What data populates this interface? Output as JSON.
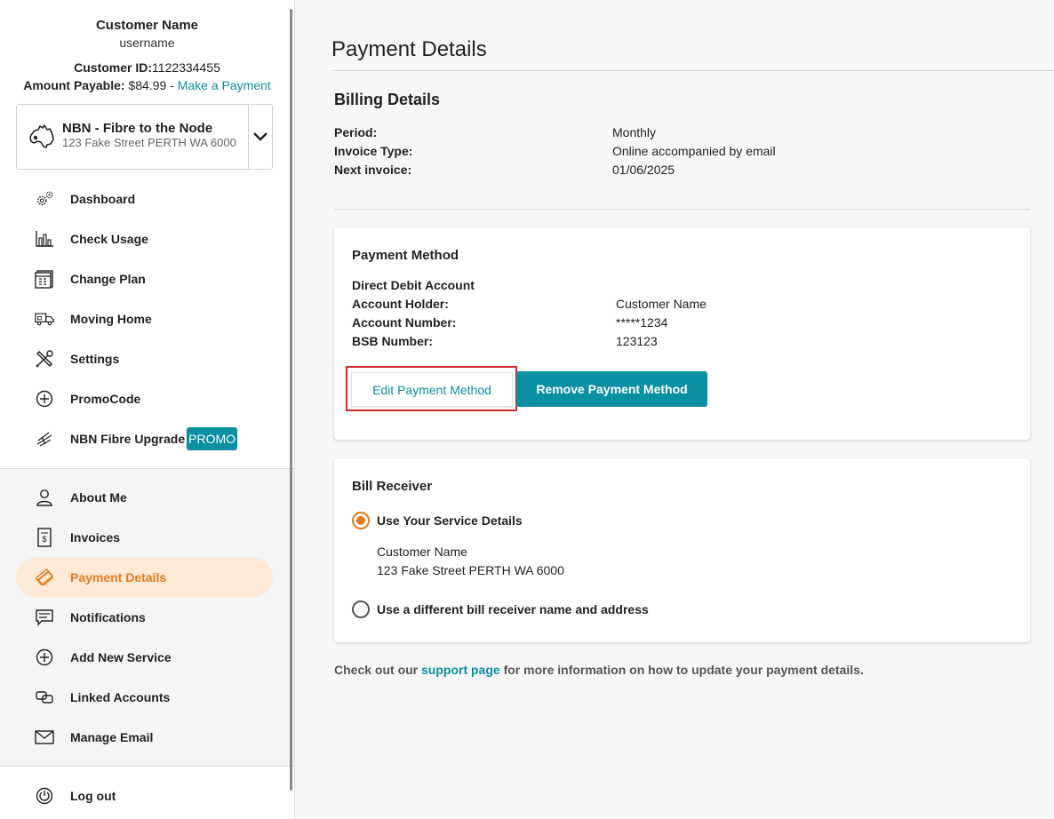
{
  "customer": {
    "name": "Customer Name",
    "username": "username",
    "id_label": "Customer ID:",
    "id_value": "1122334455",
    "amount_label": "Amount Payable:",
    "amount_value": "$84.99",
    "amount_separator": " - ",
    "make_payment_link": "Make a Payment"
  },
  "service": {
    "title": "NBN - Fibre to the Node",
    "address": "123 Fake Street PERTH WA 6000"
  },
  "sidebar": {
    "primary_items": [
      {
        "label": "Dashboard",
        "icon": "gears-icon"
      },
      {
        "label": "Check Usage",
        "icon": "bar-chart-icon"
      },
      {
        "label": "Change Plan",
        "icon": "calendar-icon"
      },
      {
        "label": "Moving Home",
        "icon": "truck-icon"
      },
      {
        "label": "Settings",
        "icon": "tools-icon"
      },
      {
        "label": "PromoCode",
        "icon": "plus-circle-icon"
      },
      {
        "label": "NBN Fibre Upgrade",
        "icon": "fibre-icon",
        "badge": "PROMO"
      }
    ],
    "secondary_items": [
      {
        "label": "About Me",
        "icon": "person-icon"
      },
      {
        "label": "Invoices",
        "icon": "invoice-icon"
      },
      {
        "label": "Payment Details",
        "icon": "cards-icon",
        "active": true
      },
      {
        "label": "Notifications",
        "icon": "chat-icon"
      },
      {
        "label": "Add New Service",
        "icon": "plus-circle-icon"
      },
      {
        "label": "Linked Accounts",
        "icon": "linked-icon"
      },
      {
        "label": "Manage Email",
        "icon": "envelope-icon"
      }
    ],
    "logout": {
      "label": "Log out",
      "icon": "power-icon"
    }
  },
  "main": {
    "title": "Payment Details",
    "billing": {
      "heading": "Billing Details",
      "rows": [
        {
          "label": "Period:",
          "value": "Monthly"
        },
        {
          "label": "Invoice Type:",
          "value": "Online accompanied by email"
        },
        {
          "label": "Next invoice:",
          "value": "01/06/2025"
        }
      ]
    },
    "payment_method": {
      "heading": "Payment Method",
      "type": "Direct Debit Account",
      "rows": [
        {
          "label": "Account Holder:",
          "value": "Customer Name"
        },
        {
          "label": "Account Number:",
          "value": "*****1234"
        },
        {
          "label": "BSB Number:",
          "value": "123123"
        }
      ],
      "edit_label": "Edit Payment Method",
      "remove_label": "Remove Payment Method"
    },
    "bill_receiver": {
      "heading": "Bill Receiver",
      "option_service": "Use Your Service Details",
      "service_name": "Customer Name",
      "service_address": "123 Fake Street PERTH WA 6000",
      "option_different": "Use a different bill receiver name and address"
    },
    "footer": {
      "prefix": "Check out our ",
      "link": "support page",
      "suffix": " for more information on how to update your payment details."
    }
  },
  "colors": {
    "accent_teal": "#0a8fa3",
    "accent_orange": "#e87a1e",
    "highlight_red": "#d9262e"
  }
}
